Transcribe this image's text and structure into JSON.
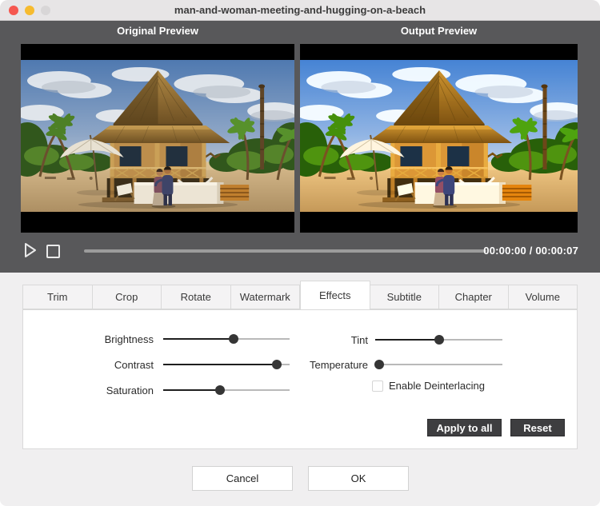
{
  "window": {
    "title": "man-and-woman-meeting-and-hugging-on-a-beach"
  },
  "preview": {
    "original_label": "Original Preview",
    "output_label": "Output Preview"
  },
  "playback": {
    "time_display": "00:00:00 / 00:00:07",
    "time_current": "00:00:00",
    "time_total": "00:00:07",
    "progress_percent": 0
  },
  "tabs": {
    "active_index": 4,
    "items": [
      {
        "label": "Trim"
      },
      {
        "label": "Crop"
      },
      {
        "label": "Rotate"
      },
      {
        "label": "Watermark"
      },
      {
        "label": "Effects"
      },
      {
        "label": "Subtitle"
      },
      {
        "label": "Chapter"
      },
      {
        "label": "Volume"
      }
    ]
  },
  "effects": {
    "sliders": [
      {
        "label": "Brightness",
        "value": 56
      },
      {
        "label": "Contrast",
        "value": 90
      },
      {
        "label": "Saturation",
        "value": 45
      },
      {
        "label": "Tint",
        "value": 50
      },
      {
        "label": "Temperature",
        "value": 3
      }
    ],
    "deinterlacing": {
      "label": "Enable Deinterlacing",
      "checked": false
    },
    "apply_all_label": "Apply to all",
    "reset_label": "Reset"
  },
  "footer": {
    "cancel_label": "Cancel",
    "ok_label": "OK"
  },
  "colors": {
    "titlebar_bg": "#e7e5e6",
    "panel_dark_bg": "#58585a",
    "content_bg": "#f0eff0",
    "tab_bg": "#f4f3f4",
    "tab_active_bg": "#ffffff",
    "border": "#d9d9d9",
    "button_dark_bg": "#3e3e40",
    "button_dark_text": "#ffffff",
    "slider_fill": "#1f1f1f",
    "slider_track": "#9c9c9c",
    "slider_track_light": "#b9b9b9",
    "traffic_red": "#f5574f",
    "traffic_yellow": "#f6bb2f",
    "traffic_gray": "#d8d6d7"
  }
}
